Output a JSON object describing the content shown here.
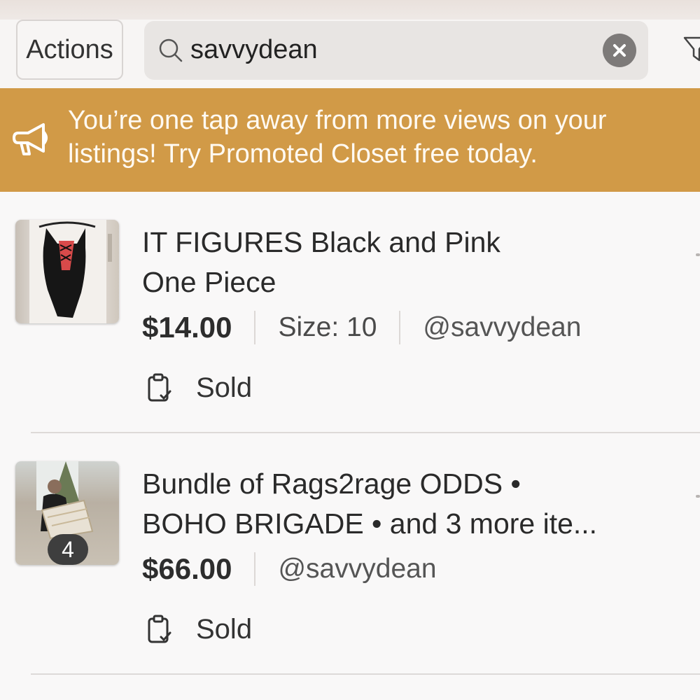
{
  "toolbar": {
    "actions_label": "Actions",
    "search_value": "savvydean"
  },
  "banner": {
    "line1": "You’re one tap away from more views on your",
    "line2": "listings! Try Promoted Closet free today."
  },
  "listings": [
    {
      "title_line1": "IT FIGURES Black and Pink",
      "title_line2": "One Piece",
      "price": "$14.00",
      "size": "Size: 10",
      "seller": "@savvydean",
      "status": "Sold"
    },
    {
      "title_line1": "Bundle of Rags2rage ODDS •",
      "title_line2": "BOHO BRIGADE • and 3 more ite...",
      "price": "$66.00",
      "seller": "@savvydean",
      "status": "Sold",
      "image_count": "4"
    }
  ],
  "colors": {
    "banner": "#d19a47",
    "background": "#f9f8f8"
  }
}
